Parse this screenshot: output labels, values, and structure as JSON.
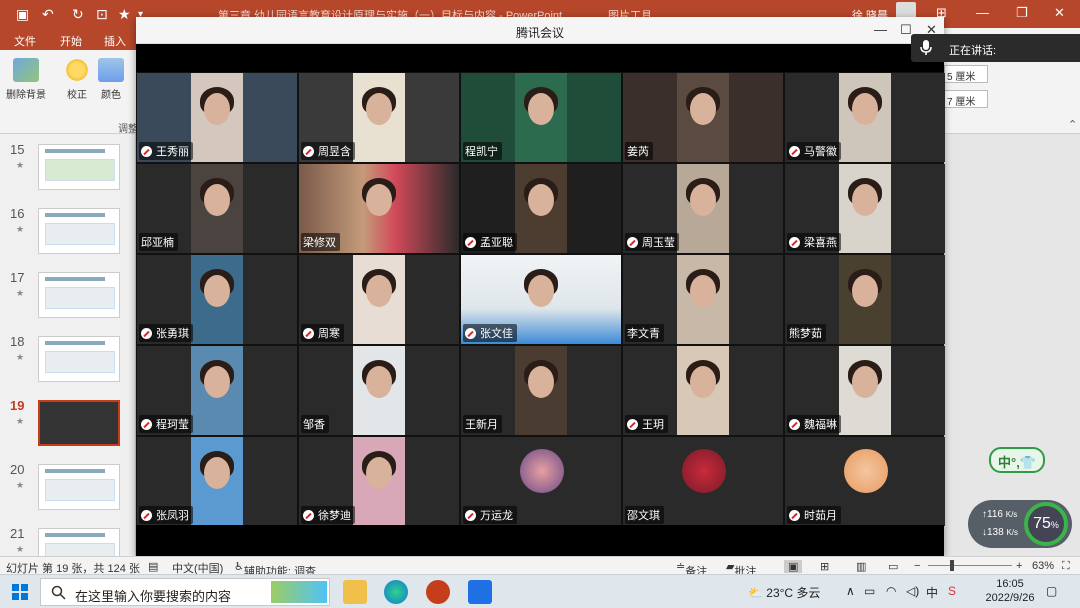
{
  "powerpoint": {
    "doc_title": "第三章  幼儿园语言教育设计原理与实施（一）目标与内容 - PowerPoint",
    "contextual_tab": "图片工具",
    "user_name": "徐 晓晨",
    "tabs": [
      "文件",
      "开始",
      "插入"
    ],
    "ribbon_items": [
      "删除背景",
      "校正",
      "颜色"
    ],
    "ribbon_group": "调整",
    "size_fields": [
      "5 厘米",
      "7 厘米"
    ]
  },
  "slides": [
    {
      "num": "15"
    },
    {
      "num": "16"
    },
    {
      "num": "17"
    },
    {
      "num": "18"
    },
    {
      "num": "19"
    },
    {
      "num": "20"
    },
    {
      "num": "21"
    }
  ],
  "meeting": {
    "title": "腾讯会议",
    "speaking_label": "正在讲话:",
    "participants": [
      {
        "name": "王秀丽",
        "muted": true
      },
      {
        "name": "周昱含",
        "muted": true
      },
      {
        "name": "程凯宁",
        "muted": false
      },
      {
        "name": "姜芮",
        "muted": false
      },
      {
        "name": "马警徽",
        "muted": true
      },
      {
        "name": "邱亚楠",
        "muted": false
      },
      {
        "name": "梁修双",
        "muted": false
      },
      {
        "name": "孟亚聪",
        "muted": true
      },
      {
        "name": "周玉莹",
        "muted": true
      },
      {
        "name": "梁喜燕",
        "muted": true
      },
      {
        "name": "张勇琪",
        "muted": true
      },
      {
        "name": "周寒",
        "muted": true
      },
      {
        "name": "张文佳",
        "muted": true
      },
      {
        "name": "李文青",
        "muted": false
      },
      {
        "name": "熊梦茹",
        "muted": false
      },
      {
        "name": "程珂莹",
        "muted": true
      },
      {
        "name": "邹香",
        "muted": false
      },
      {
        "name": "王新月",
        "muted": false
      },
      {
        "name": "王玥",
        "muted": true
      },
      {
        "name": "魏福琳",
        "muted": true
      },
      {
        "name": "张凤羽",
        "muted": true
      },
      {
        "name": "徐梦迪",
        "muted": true
      },
      {
        "name": "万运龙",
        "muted": true
      },
      {
        "name": "邵文琪",
        "muted": false
      },
      {
        "name": "时茹月",
        "muted": true
      }
    ]
  },
  "status_bar": {
    "slide_info": "幻灯片 第 19 张，共 124 张",
    "language": "中文(中国)",
    "accessibility": "辅助功能: 调查",
    "notes": "备注",
    "comments": "批注",
    "zoom": "63%"
  },
  "taskbar": {
    "search_placeholder": "在这里输入你要搜索的内容",
    "weather": "23°C  多云",
    "time": "16:05",
    "date": "2022/9/26",
    "ime": "中",
    "lang_tray": "中"
  },
  "widgets": {
    "ime_text": "中°,👕",
    "upload": "116",
    "upload_unit": "K/s",
    "download": "138",
    "download_unit": "K/s",
    "cpu": "75",
    "cpu_unit": "%"
  }
}
